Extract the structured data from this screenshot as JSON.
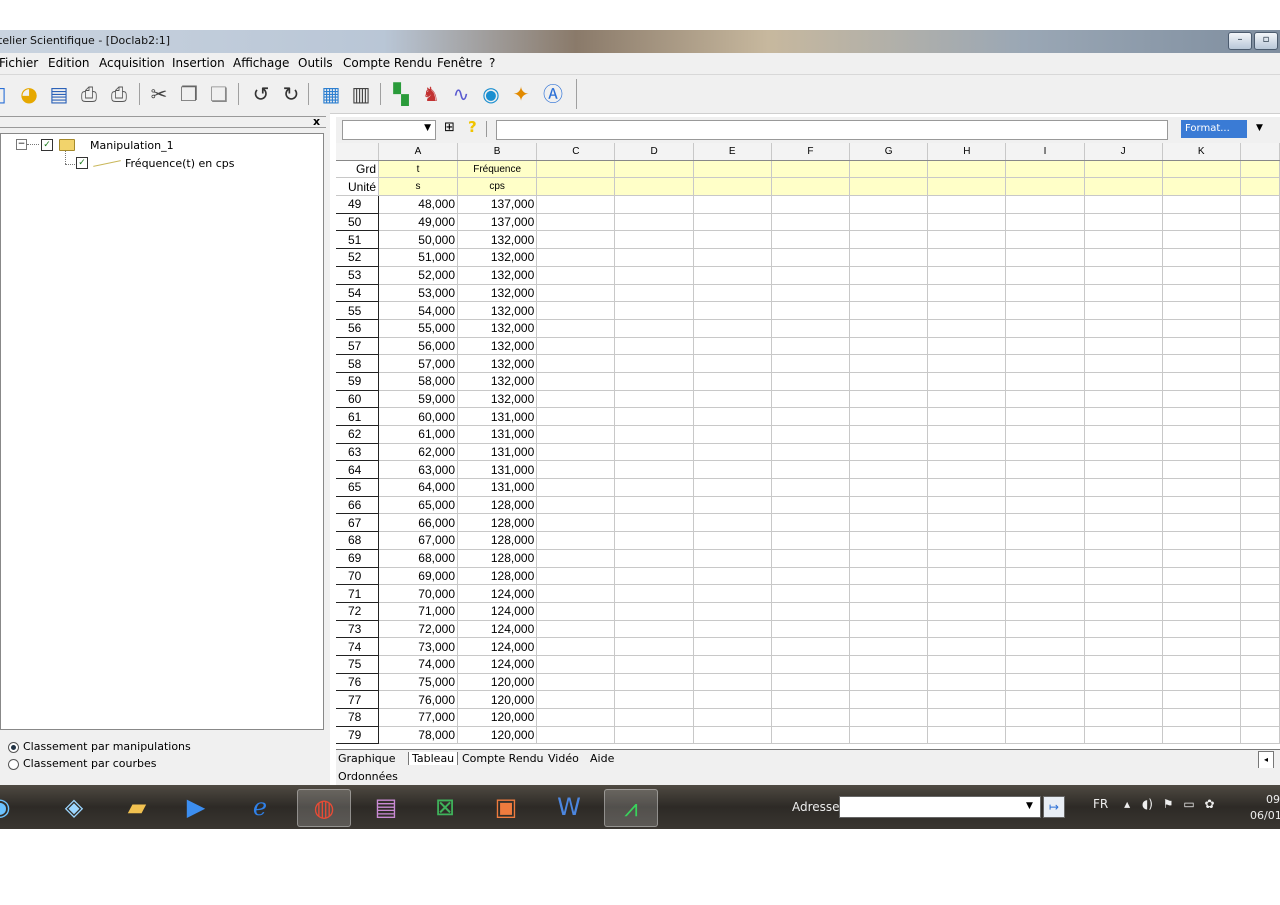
{
  "window": {
    "title": "telier Scientifique - [Doclab2:1]",
    "min_label": "–",
    "max_label": "▫"
  },
  "menu": [
    "Fichier",
    "Edition",
    "Acquisition",
    "Insertion",
    "Affichage",
    "Outils",
    "Compte Rendu",
    "Fenêtre",
    "?"
  ],
  "toolbar": {
    "icons": [
      "new-icon",
      "open-icon",
      "save-icon",
      "print-icon",
      "print-preview-icon",
      "cut-icon",
      "copy-icon",
      "paste-icon",
      "undo-icon",
      "redo-icon",
      "calculator-icon",
      "table-icon",
      "chart-icon",
      "model-icon",
      "curve-icon",
      "globe-icon",
      "tools-icon",
      "text-icon"
    ]
  },
  "tree": {
    "root_label": "Manipulation_1",
    "child_label": "Fréquence(t) en cps"
  },
  "panel_options": {
    "by_manip": "Classement par manipulations",
    "by_curve": "Classement par courbes"
  },
  "formula_bar": {
    "format_label": "Format..."
  },
  "sheet": {
    "columns": [
      "A",
      "B",
      "C",
      "D",
      "E",
      "F",
      "G",
      "H",
      "I",
      "J",
      "K"
    ],
    "grd_label": "Grd",
    "unit_label": "Unité",
    "magnitudes": [
      "t",
      "Fréquence"
    ],
    "units": [
      "s",
      "cps"
    ],
    "rows": [
      [
        "49",
        "48,000",
        "137,000"
      ],
      [
        "50",
        "49,000",
        "137,000"
      ],
      [
        "51",
        "50,000",
        "132,000"
      ],
      [
        "52",
        "51,000",
        "132,000"
      ],
      [
        "53",
        "52,000",
        "132,000"
      ],
      [
        "54",
        "53,000",
        "132,000"
      ],
      [
        "55",
        "54,000",
        "132,000"
      ],
      [
        "56",
        "55,000",
        "132,000"
      ],
      [
        "57",
        "56,000",
        "132,000"
      ],
      [
        "58",
        "57,000",
        "132,000"
      ],
      [
        "59",
        "58,000",
        "132,000"
      ],
      [
        "60",
        "59,000",
        "132,000"
      ],
      [
        "61",
        "60,000",
        "131,000"
      ],
      [
        "62",
        "61,000",
        "131,000"
      ],
      [
        "63",
        "62,000",
        "131,000"
      ],
      [
        "64",
        "63,000",
        "131,000"
      ],
      [
        "65",
        "64,000",
        "131,000"
      ],
      [
        "66",
        "65,000",
        "128,000"
      ],
      [
        "67",
        "66,000",
        "128,000"
      ],
      [
        "68",
        "67,000",
        "128,000"
      ],
      [
        "69",
        "68,000",
        "128,000"
      ],
      [
        "70",
        "69,000",
        "128,000"
      ],
      [
        "71",
        "70,000",
        "124,000"
      ],
      [
        "72",
        "71,000",
        "124,000"
      ],
      [
        "73",
        "72,000",
        "124,000"
      ],
      [
        "74",
        "73,000",
        "124,000"
      ],
      [
        "75",
        "74,000",
        "124,000"
      ],
      [
        "76",
        "75,000",
        "120,000"
      ],
      [
        "77",
        "76,000",
        "120,000"
      ],
      [
        "78",
        "77,000",
        "120,000"
      ],
      [
        "79",
        "78,000",
        "120,000"
      ]
    ]
  },
  "tabs": [
    "Graphique",
    "Tableau",
    "Compte Rendu",
    "Vidéo",
    "Aide"
  ],
  "status": "Ordonnées",
  "taskbar": {
    "address_label": "Adresse",
    "lang": "FR",
    "time": "09",
    "date": "06/01"
  },
  "colors": {
    "meta_row": "#ffffc8",
    "format_button": "#3a7bd5"
  }
}
